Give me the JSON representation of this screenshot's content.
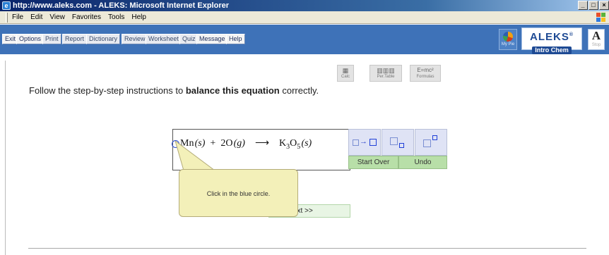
{
  "window": {
    "title": "http://www.aleks.com - ALEKS: Microsoft Internet Explorer",
    "controls": [
      "_",
      "□",
      "×"
    ]
  },
  "menu": [
    "File",
    "Edit",
    "View",
    "Favorites",
    "Tools",
    "Help"
  ],
  "toolbar": {
    "buttons": [
      "Exit",
      "Options",
      "Print",
      "Report",
      "Dictionary",
      "Review",
      "Worksheet",
      "Quiz",
      "Message",
      "Help"
    ],
    "mypie_label": "My Pie",
    "logo_main": "ALEKS",
    "logo_reg": "®",
    "logo_sub": "Intro Chem",
    "stop_glyph": "A",
    "stop_label": "Stop"
  },
  "tools": {
    "calc": "Calc",
    "pertable": "Per.Table",
    "formulas_glyph": "E=mc²",
    "formulas": "Formulas"
  },
  "instructions": {
    "before": "Follow the step-by-step instructions to ",
    "bold": "balance this equation",
    "after": " correctly."
  },
  "equation": {
    "reactant1": "Mn",
    "state1": "(s)",
    "plus": "+",
    "reactant2": "2O",
    "state2": "(g)",
    "arrow": "⟶",
    "product_k": "K",
    "sub_k": "3",
    "product_o": "O",
    "sub_o": "5",
    "state3": "(s)"
  },
  "panel": {
    "start_over": "Start Over",
    "undo": "Undo"
  },
  "callout": "Click in the blue circle.",
  "next_label": "ext >>",
  "colors": {
    "toolbar_blue": "#3e72b8",
    "callout_yellow": "#f3f0b9",
    "action_green": "#b8dfa8",
    "circle_blue": "#2c4fd0"
  }
}
